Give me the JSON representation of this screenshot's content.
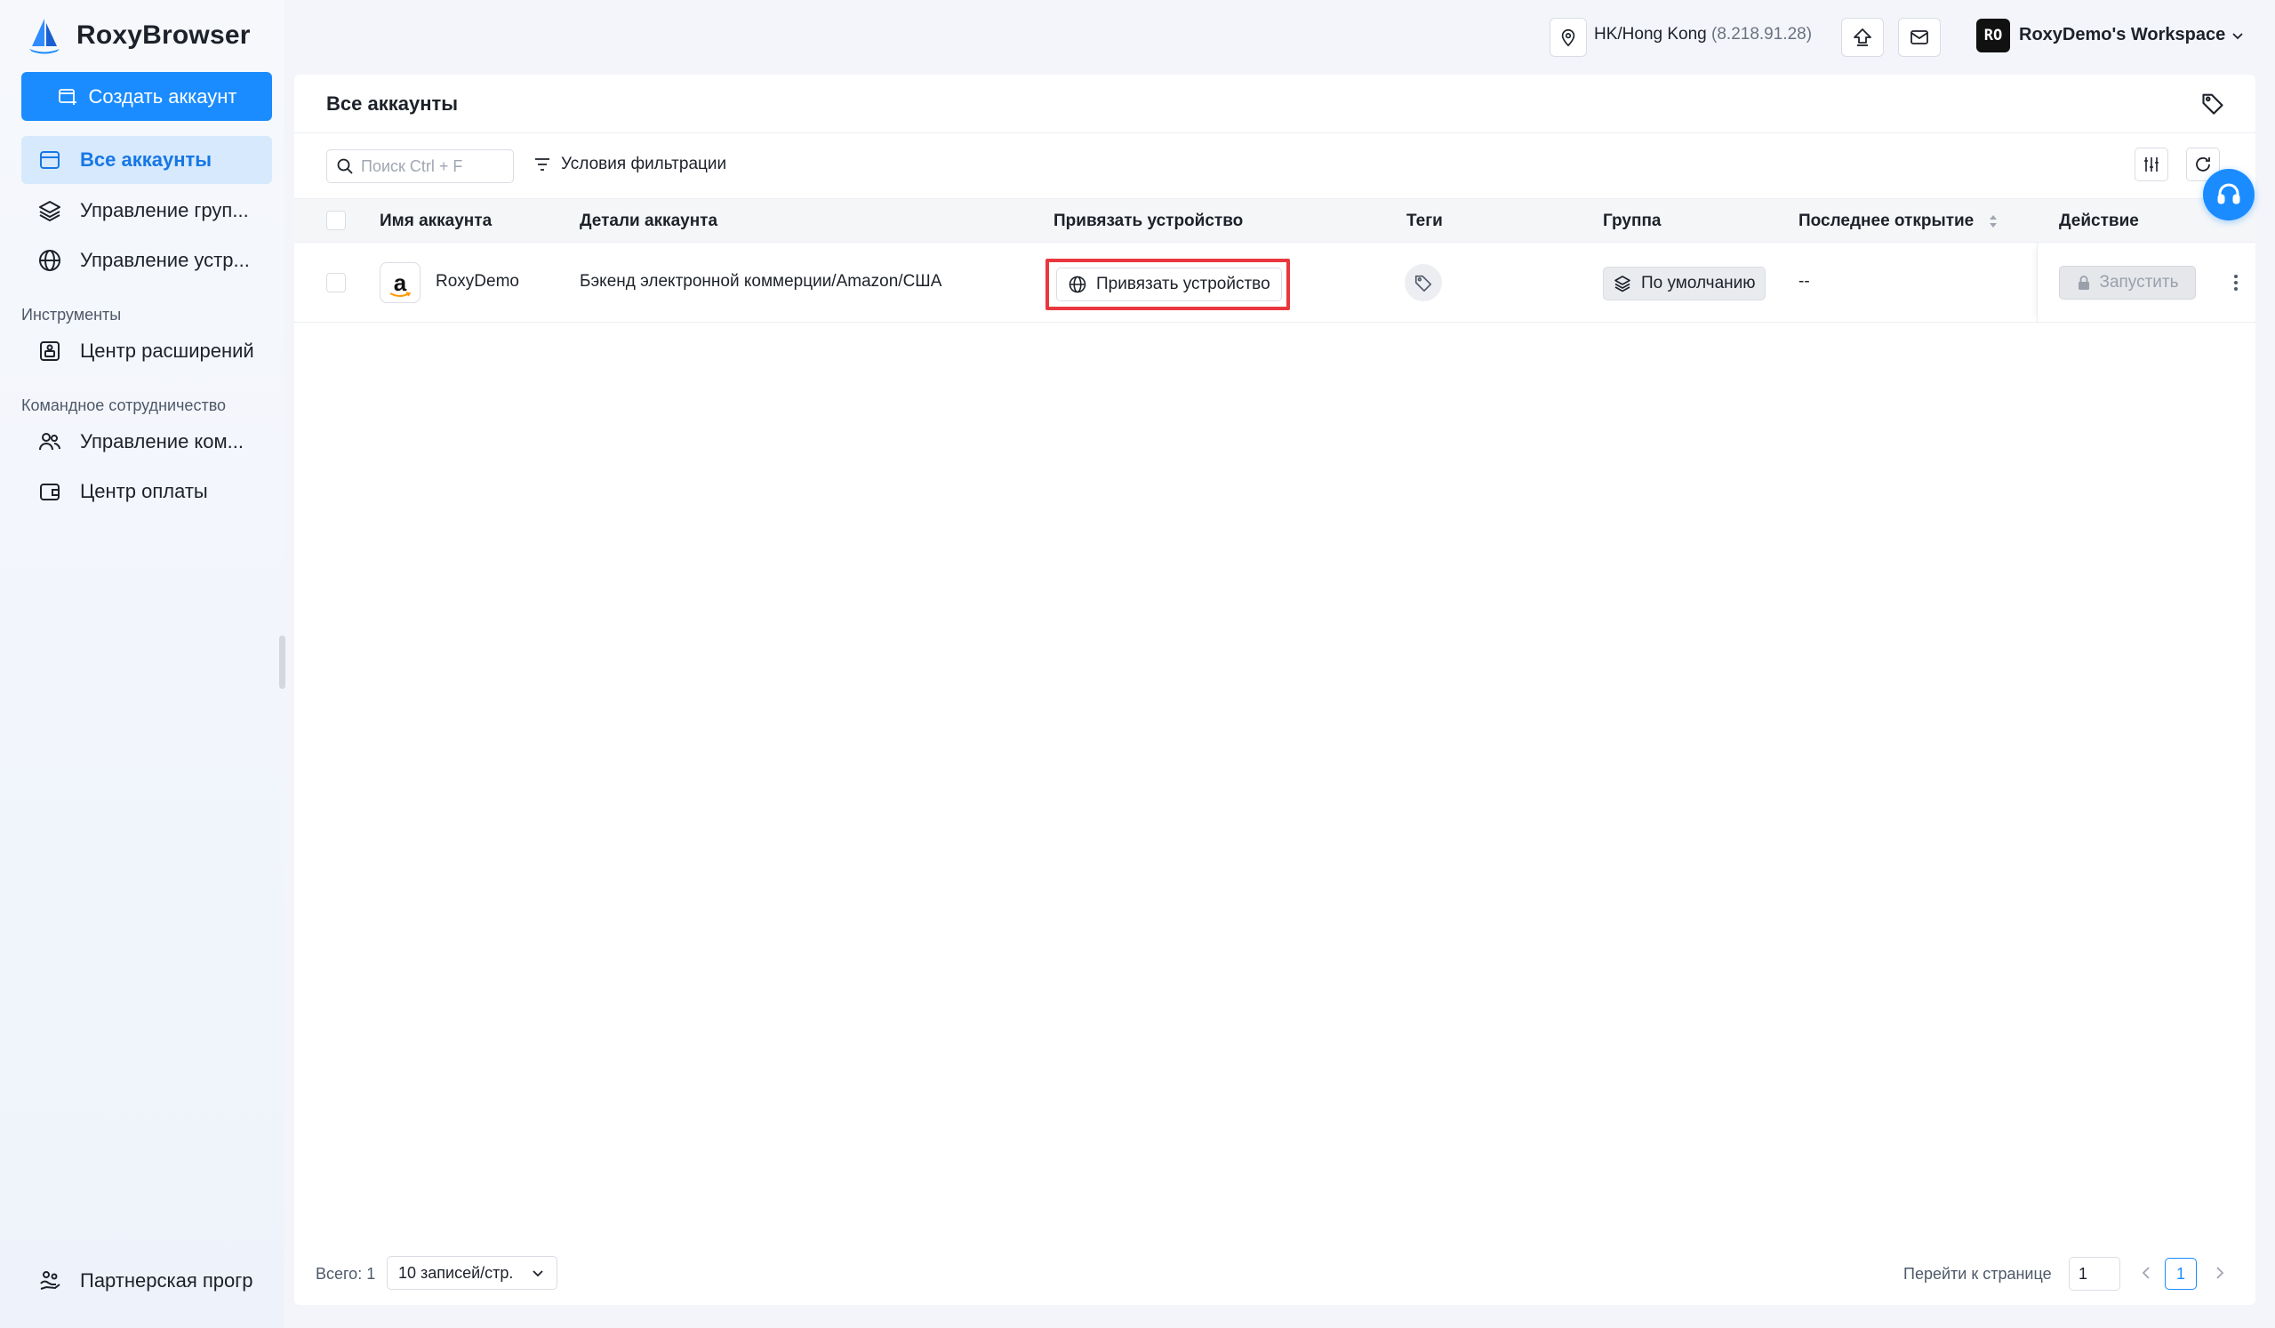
{
  "app": {
    "name": "RoxyBrowser"
  },
  "sidebar": {
    "create_label": "Создать аккаунт",
    "items": [
      {
        "label": "Все аккаунты",
        "icon": "accounts-icon"
      },
      {
        "label": "Управление груп...",
        "icon": "layers-icon"
      },
      {
        "label": "Управление устр...",
        "icon": "globe-icon"
      }
    ],
    "section_tools": "Инструменты",
    "tools": [
      {
        "label": "Центр расширений",
        "icon": "extensions-icon"
      }
    ],
    "section_team": "Командное сотрудничество",
    "team": [
      {
        "label": "Управление ком...",
        "icon": "team-icon"
      },
      {
        "label": "Центр оплаты",
        "icon": "wallet-icon"
      }
    ],
    "partner_label": "Партнерская прогр"
  },
  "topbar": {
    "location": "HK/Hong Kong",
    "ip": "(8.218.91.28)",
    "workspace_avatar": "RO",
    "workspace_name": "RoxyDemo's Workspace"
  },
  "main": {
    "title": "Все аккаунты",
    "search_placeholder": "Поиск Ctrl + F",
    "filter_label": "Условия фильтрации",
    "columns": {
      "name": "Имя аккаунта",
      "details": "Детали аккаунта",
      "bind": "Привязать устройство",
      "tags": "Теги",
      "group": "Группа",
      "last_open": "Последнее открытие",
      "action": "Действие"
    },
    "rows": [
      {
        "name": "RoxyDemo",
        "platform_letter": "a",
        "details": "Бэкенд электронной коммерции/Amazon/США",
        "bind_label": "Привязать устройство",
        "group": "По умолчанию",
        "last_open": "--",
        "launch_label": "Запустить"
      }
    ]
  },
  "footer": {
    "total": "Всего: 1",
    "page_size": "10 записей/стр.",
    "goto_label": "Перейти к странице",
    "goto_value": "1",
    "current_page": "1"
  },
  "colors": {
    "accent": "#1a8cff",
    "highlight": "#e8373e"
  }
}
